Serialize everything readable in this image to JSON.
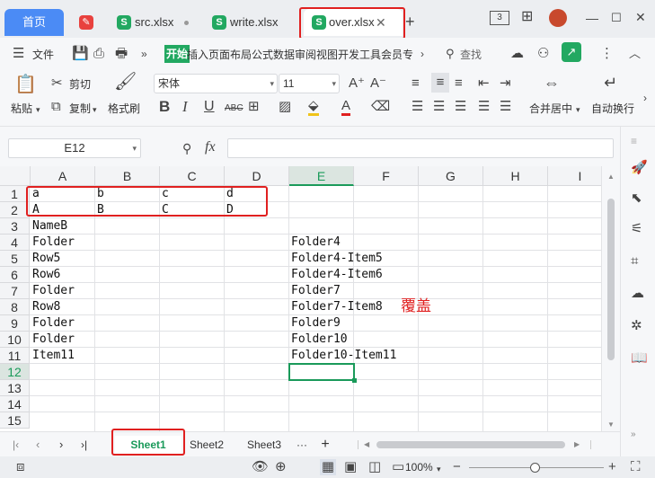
{
  "titlebar": {
    "home_tab": "首页",
    "tabs": [
      {
        "label": "src.xlsx",
        "badge": "S"
      },
      {
        "label": "write.xlsx",
        "badge": "S"
      },
      {
        "label": "over.xlsx",
        "badge": "S"
      }
    ],
    "window_badge": "3",
    "colors": {
      "home": "#4b8bf5",
      "badge": "#22a861",
      "pdf_badge": "#e8413e"
    }
  },
  "menu": {
    "file": "文件",
    "start": "开始",
    "rest": "插入页面布局公式数据审阅视图开发工具会员专",
    "search": "查找"
  },
  "ribbon": {
    "paste": "粘贴",
    "cut": "剪切",
    "copy": "复制",
    "format_painter": "格式刷",
    "font_name": "宋体",
    "font_size": "11",
    "bold": "B",
    "italic": "I",
    "underline": "U",
    "strike": "ABC",
    "merge_center": "合并居中",
    "wrap": "自动换行"
  },
  "formula_bar": {
    "name_box": "E12",
    "fx": "fx",
    "value": ""
  },
  "grid": {
    "columns": [
      "A",
      "B",
      "C",
      "D",
      "E",
      "F",
      "G",
      "H",
      "I"
    ],
    "selected_column": "E",
    "rows": [
      "1",
      "2",
      "3",
      "4",
      "5",
      "6",
      "7",
      "8",
      "9",
      "10",
      "11",
      "12",
      "13",
      "14",
      "15"
    ],
    "selected_row": "12",
    "cells": {
      "A1": "a",
      "B1": "b",
      "C1": "c",
      "D1": "d",
      "A2": "A",
      "B2": "B",
      "C2": "C",
      "D2": "D",
      "A3": "NameB",
      "A4": "Folder",
      "E4": "Folder4",
      "A5": "Row5",
      "E5": "Folder4-Item5",
      "A6": "Row6",
      "E6": "Folder4-Item6",
      "A7": "Folder",
      "E7": "Folder7",
      "A8": "Row8",
      "E8": "Folder7-Item8",
      "A9": "Folder",
      "E9": "Folder9",
      "A10": "Folder",
      "E10": "Folder10",
      "A11": "Item11",
      "E11": "Folder10-Item11"
    },
    "annotation": "覆盖"
  },
  "sheets": {
    "tabs": [
      "Sheet1",
      "Sheet2",
      "Sheet3"
    ],
    "active": "Sheet1",
    "more": "···",
    "add": "+"
  },
  "status": {
    "zoom": "100%"
  }
}
